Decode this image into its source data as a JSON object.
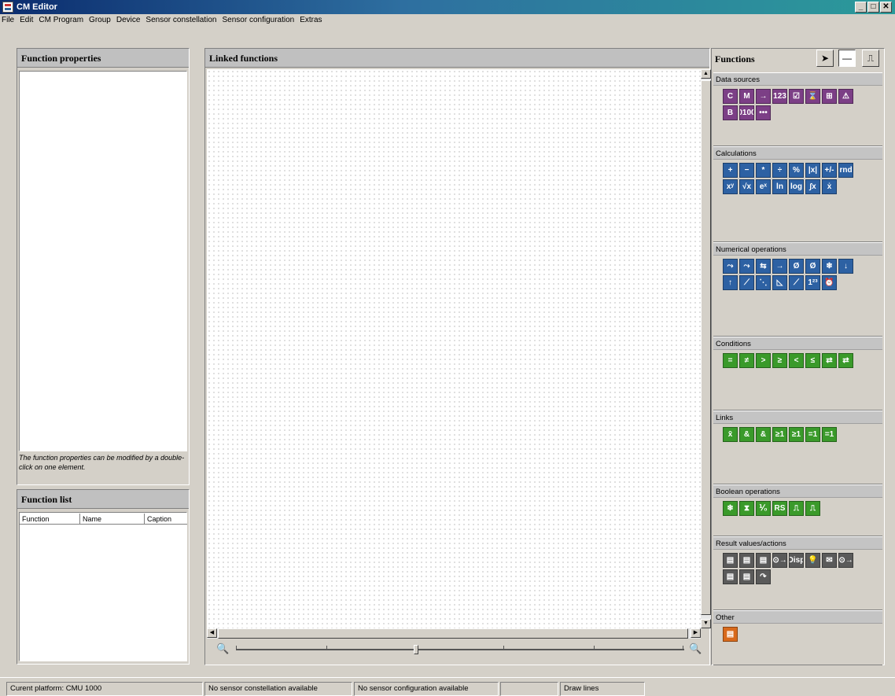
{
  "window": {
    "title": "CM Editor",
    "controls": [
      "_",
      "□",
      "✕"
    ]
  },
  "menu": [
    "File",
    "Edit",
    "CM Program",
    "Group",
    "Device",
    "Sensor constellation",
    "Sensor configuration",
    "Extras"
  ],
  "function_properties": {
    "title": "Function properties",
    "note": "The function properties can be modified by a double-click on one element."
  },
  "function_list": {
    "title": "Function list",
    "columns": [
      "Function",
      "Name",
      "Caption"
    ]
  },
  "linked": {
    "title": "Linked functions",
    "zoom_out_icon": "zoom-out-icon",
    "zoom_in_icon": "zoom-in-icon"
  },
  "functions": {
    "title": "Functions",
    "tools": [
      "pointer-tool",
      "line-tool",
      "pulse-tool"
    ],
    "categories": [
      {
        "name": "Data sources",
        "color": "purple",
        "icons": [
          "C",
          "M",
          "→",
          "123",
          "☑",
          "⌛",
          "⊞",
          "⚠",
          "B",
          "0100",
          "•••"
        ]
      },
      {
        "name": "Calculations",
        "color": "blue",
        "icons": [
          "+",
          "−",
          "*",
          "÷",
          "%",
          "|x|",
          "+/-",
          "rnd",
          "xʸ",
          "√x",
          "eˣ",
          "ln",
          "log",
          "∫x",
          "ẋ"
        ]
      },
      {
        "name": "Numerical operations",
        "color": "blue",
        "icons": [
          "⤳",
          "⤳",
          "⇆",
          "→",
          "Ø",
          "Ø",
          "❄",
          "↓",
          "↑",
          "⟋",
          "⋱",
          "◺",
          "⟋",
          "1²³",
          "⏰"
        ]
      },
      {
        "name": "Conditions",
        "color": "green",
        "icons": [
          "=",
          "≠",
          ">",
          "≥",
          "<",
          "≤",
          "⇄",
          "⇄"
        ]
      },
      {
        "name": "Links",
        "color": "green",
        "icons": [
          "x̄",
          "&",
          "&",
          "≥1",
          "≥1",
          "=1",
          "=1"
        ]
      },
      {
        "name": "Boolean operations",
        "color": "green",
        "icons": [
          "❄",
          "⧗",
          "⅟₀",
          "RS",
          "⎍",
          "⎍"
        ]
      },
      {
        "name": "Result values/actions",
        "color": "dark",
        "icons": [
          "▤",
          "▤",
          "▤",
          "⊙→",
          "Disp",
          "💡",
          "✉",
          "⊙→",
          "▤",
          "▤",
          "↷"
        ]
      },
      {
        "name": "Other",
        "color": "orange",
        "icons": [
          "▤"
        ]
      }
    ]
  },
  "status": [
    "Curent platform: CMU 1000",
    "No sensor constellation available",
    "No sensor configuration available",
    "",
    "Draw lines"
  ]
}
